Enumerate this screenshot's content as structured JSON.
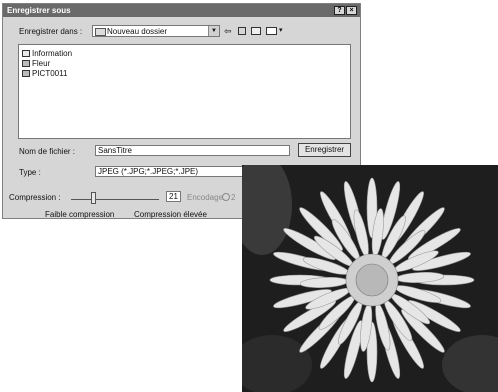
{
  "dialog": {
    "title": "Enregistrer sous",
    "help_button": "?",
    "close_button": "×",
    "save_in_label": "Enregistrer dans :",
    "save_in_value": "Nouveau dossier",
    "files": [
      {
        "name": "Information",
        "type": "folder"
      },
      {
        "name": "Fleur",
        "type": "image"
      },
      {
        "name": "PICT0011",
        "type": "image"
      }
    ],
    "filename_label": "Nom de fichier :",
    "filename_value": "SansTitre",
    "save_button": "Enregistrer",
    "type_label": "Type :",
    "type_value": "JPEG (*.JPG;*.JPEG;*.JPE)",
    "compression_label": "Compression :",
    "compression_value": "21",
    "encoding_label": "Encodage",
    "encoding_option": "2",
    "low_compression_label": "Faible compression",
    "high_compression_label": "Compression élevée"
  }
}
